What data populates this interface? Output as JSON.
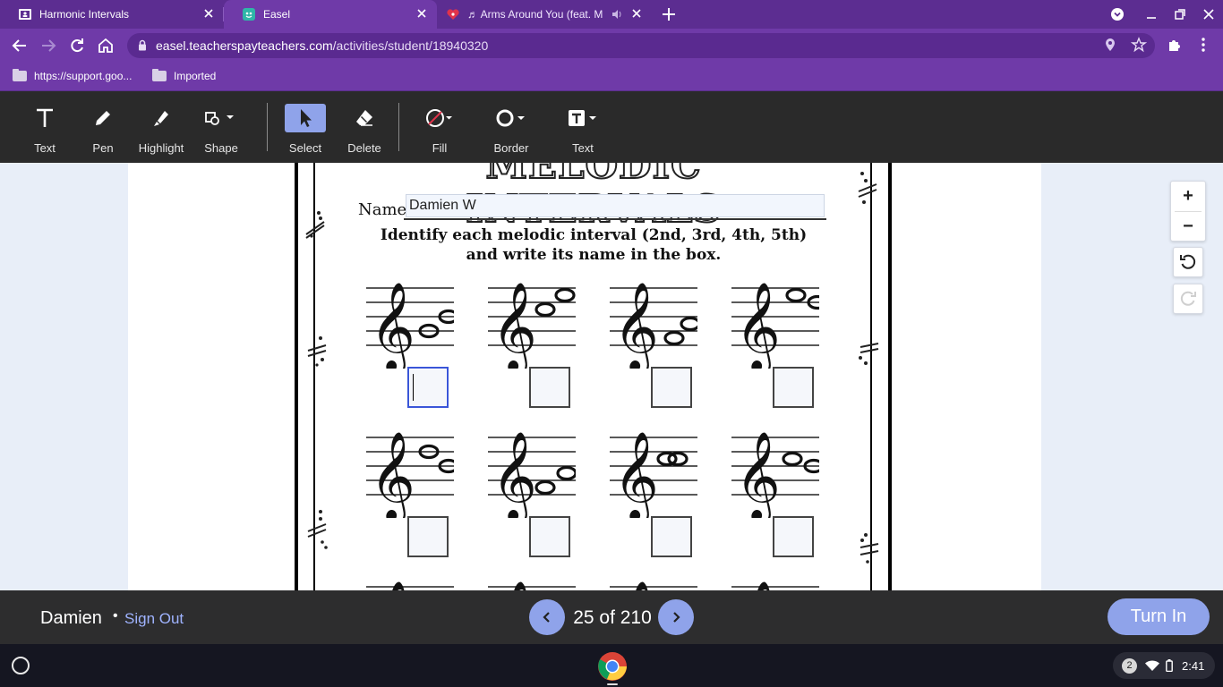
{
  "browser": {
    "tabs": [
      {
        "title": "Harmonic Intervals",
        "icon": "classroom-icon"
      },
      {
        "title": "Easel",
        "icon": "easel-icon"
      },
      {
        "title": "♬ Arms Around You (feat. M",
        "icon": "iheart-icon"
      }
    ],
    "url_host": "easel.teacherspayteachers.com",
    "url_path": "/activities/student/18940320",
    "bookmarks": [
      {
        "label": "https://support.goo..."
      },
      {
        "label": "Imported"
      }
    ]
  },
  "toolbar": {
    "tools": [
      {
        "label": "Text",
        "icon": "text-tool-icon"
      },
      {
        "label": "Pen",
        "icon": "pen-icon"
      },
      {
        "label": "Highlight",
        "icon": "highlighter-icon"
      },
      {
        "label": "Shape",
        "icon": "shape-icon"
      },
      {
        "label": "Select",
        "icon": "cursor-icon",
        "active": true
      },
      {
        "label": "Delete",
        "icon": "eraser-icon"
      },
      {
        "label": "Fill",
        "icon": "fill-icon"
      },
      {
        "label": "Border",
        "icon": "border-icon"
      },
      {
        "label": "Text",
        "icon": "text-format-icon"
      }
    ]
  },
  "worksheet": {
    "heading": "MELODIC INTERVALS",
    "name_label": "Name",
    "name_value": "Damien W",
    "instruction_line1": "Identify each melodic interval (2nd, 3rd, 4th, 5th)",
    "instruction_line2": "and write its name in the box."
  },
  "zoom": {
    "plus": "+",
    "minus": "−"
  },
  "footer": {
    "student_name": "Damien",
    "separator": "•",
    "sign_out": "Sign Out",
    "page_indicator": "25 of 210",
    "turn_in": "Turn In"
  },
  "system_tray": {
    "notification_count": "2",
    "time": "2:41"
  },
  "colors": {
    "tab_strip": "#5c2d91",
    "active_tab": "#6f3aa8",
    "toolbar": "#2a2a2a",
    "accent": "#8fa3ea",
    "sign_out_link": "#9fb3ff"
  }
}
